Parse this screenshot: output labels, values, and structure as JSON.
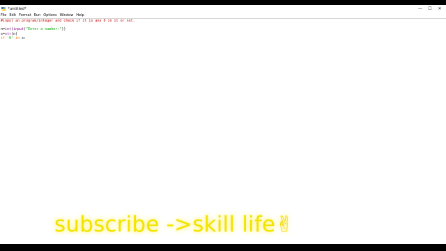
{
  "window": {
    "title": "*untitled*",
    "controls": {
      "minimize": "—",
      "maximize": "☐",
      "close": "✕"
    }
  },
  "menu": [
    "File",
    "Edit",
    "Format",
    "Run",
    "Options",
    "Window",
    "Help"
  ],
  "code": {
    "line1_comment": "#input an program/integer and check if it is any 0 in it or not.",
    "line3_a": "n=",
    "line3_int": "int",
    "line3_b": "(",
    "line3_input": "input",
    "line3_c": "(",
    "line3_str": "\"Enter a number:\"",
    "line3_d": "))",
    "line4_a": "s=",
    "line4_str": "str",
    "line4_b": "(n)",
    "line5_if": "if",
    "line5_a": " ",
    "line5_str": "'0'",
    "line5_b": " ",
    "line5_in": "in",
    "line5_c": " s:"
  },
  "overlay": {
    "caption": "subscribe ->skill life",
    "emoji": "✌"
  },
  "colors": {
    "comment": "#c00000",
    "keyword": "#ff7700",
    "builtin": "#900090",
    "string": "#00aa00",
    "caption": "#f2e400"
  },
  "icons": {
    "app": "python-idle-icon",
    "minimize": "minimize-icon",
    "maximize": "maximize-icon",
    "close": "close-icon"
  }
}
